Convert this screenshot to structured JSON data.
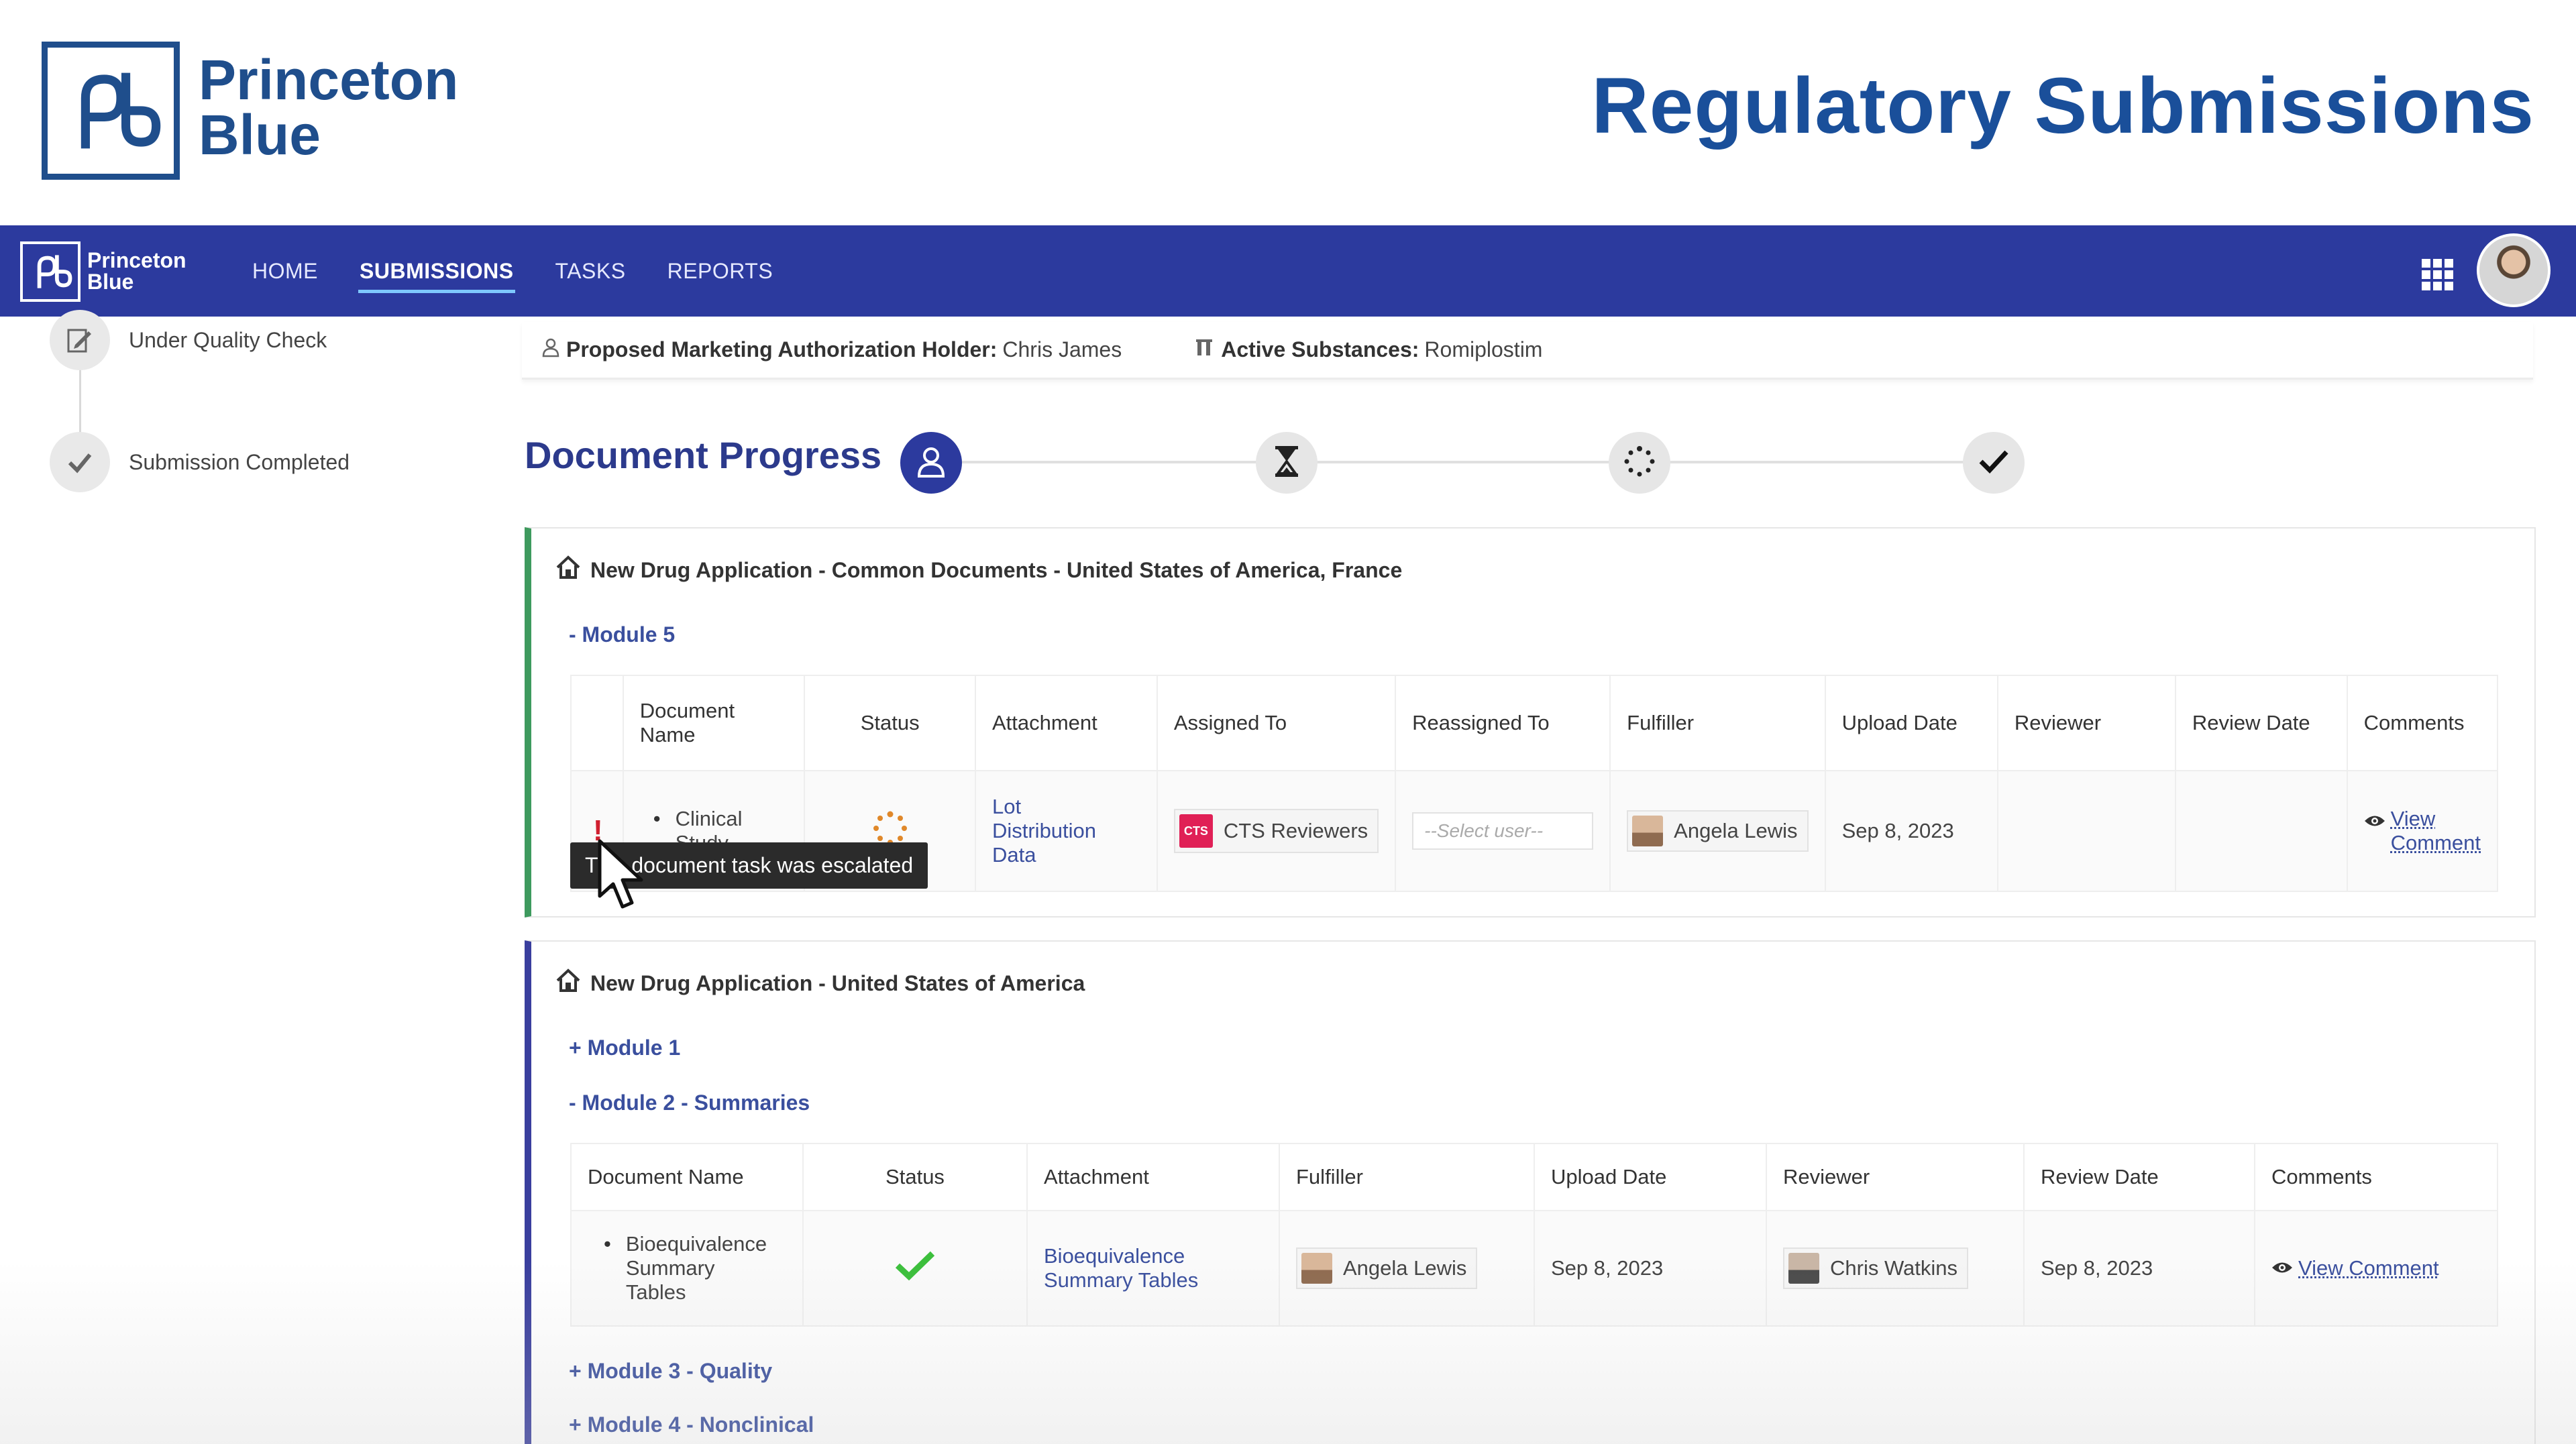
{
  "banner": {
    "brand_line1": "Princeton",
    "brand_line2": "Blue",
    "title": "Regulatory Submissions"
  },
  "navbar": {
    "brand_line1": "Princeton",
    "brand_line2": "Blue",
    "links": [
      "HOME",
      "SUBMISSIONS",
      "TASKS",
      "REPORTS"
    ],
    "active_link": "SUBMISSIONS",
    "apps_icon": "grid-icon",
    "avatar_icon": "user-avatar"
  },
  "sidebar": {
    "steps": [
      {
        "label": "Under Quality Check",
        "icon": "edit-document-icon"
      },
      {
        "label": "Submission Completed",
        "icon": "checkmark-icon"
      }
    ]
  },
  "info_bar": {
    "holder_label": "Proposed Marketing Authorization Holder:",
    "holder_value": "Chris James",
    "substances_label": "Active Substances:",
    "substances_value": "Romiplostim"
  },
  "document_progress": {
    "title": "Document Progress",
    "stages": [
      "user-icon",
      "hourglass-icon",
      "spinner-icon",
      "checkmark-icon"
    ],
    "active_stage": 0,
    "colors": {
      "active": "#2c3a9e",
      "inactive": "#e6e6e6"
    }
  },
  "panel1": {
    "title": "New Drug Application - Common Documents - United States of America, France",
    "module": "- Module 5",
    "columns": [
      "Document Name",
      "Status",
      "Attachment",
      "Assigned To",
      "Reassigned To",
      "Fulfiller",
      "Upload Date",
      "Reviewer",
      "Review Date",
      "Comments"
    ],
    "row": {
      "document_line1": "Clinical",
      "document_line2": "Study",
      "status_icon": "spinner-icon",
      "attachment_line1": "Lot",
      "attachment_line2": "Distribution",
      "attachment_line3": "Data",
      "assigned_badge": "CTS",
      "assigned_to": "CTS Reviewers",
      "reassign_placeholder": "--Select user--",
      "fulfiller": "Angela Lewis",
      "upload_date": "Sep 8, 2023",
      "reviewer": "",
      "review_date": "",
      "comment_line1": "View",
      "comment_line2": "Comment"
    },
    "escalation_mark": "!",
    "tooltip": "This document task was escalated"
  },
  "panel2": {
    "title": "New Drug Application - United States of America",
    "modules": {
      "m1": "+ Module 1",
      "m2": "- Module 2 - Summaries",
      "m3": "+ Module 3 - Quality",
      "m4": "+ Module 4 - Nonclinical"
    },
    "columns": [
      "Document Name",
      "Status",
      "Attachment",
      "Fulfiller",
      "Upload Date",
      "Reviewer",
      "Review Date",
      "Comments"
    ],
    "row": {
      "document_line1": "Bioequivalence",
      "document_line2": "Summary",
      "document_line3": "Tables",
      "status_icon": "checkmark-icon",
      "attachment_line1": "Bioequivalence",
      "attachment_line2": "Summary Tables",
      "fulfiller": "Angela Lewis",
      "upload_date": "Sep 8, 2023",
      "reviewer": "Chris Watkins",
      "review_date": "Sep 8, 2023",
      "comment": "View Comment"
    }
  }
}
